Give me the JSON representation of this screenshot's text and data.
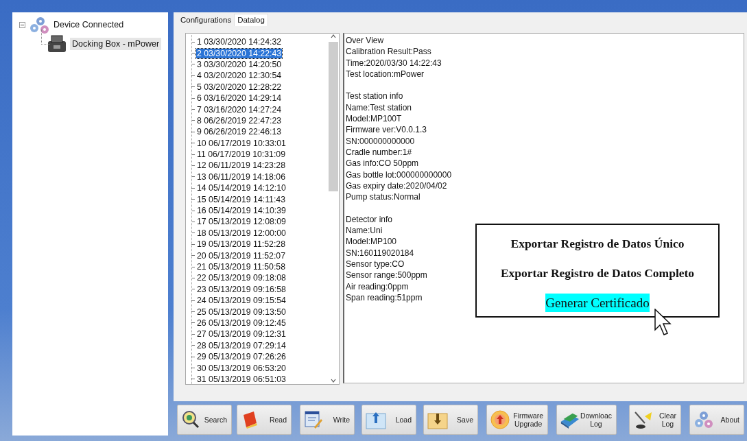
{
  "device_tree": {
    "label": "Device Connected",
    "expanded": true,
    "selected": false,
    "children": [
      {
        "label": "Docking Box - mPower",
        "selected": true
      }
    ]
  },
  "tabs": [
    {
      "label": "Configurations",
      "selected": false
    },
    {
      "label": "Datalog",
      "selected": true
    }
  ],
  "datalog_list": [
    {
      "label": "1 03/30/2020 14:24:32",
      "selected": false
    },
    {
      "label": "2 03/30/2020 14:22:43",
      "selected": true
    },
    {
      "label": "3 03/30/2020 14:20:50",
      "selected": false
    },
    {
      "label": "4 03/20/2020 12:30:54",
      "selected": false
    },
    {
      "label": "5 03/20/2020 12:28:22",
      "selected": false
    },
    {
      "label": "6 03/16/2020 14:29:14",
      "selected": false
    },
    {
      "label": "7 03/16/2020 14:27:24",
      "selected": false
    },
    {
      "label": "8 06/26/2019 22:47:23",
      "selected": false
    },
    {
      "label": "9 06/26/2019 22:46:13",
      "selected": false
    },
    {
      "label": "10 06/17/2019 10:33:01",
      "selected": false
    },
    {
      "label": "11 06/17/2019 10:31:09",
      "selected": false
    },
    {
      "label": "12 06/11/2019 14:23:28",
      "selected": false
    },
    {
      "label": "13 06/11/2019 14:18:06",
      "selected": false
    },
    {
      "label": "14 05/14/2019 14:12:10",
      "selected": false
    },
    {
      "label": "15 05/14/2019 14:11:43",
      "selected": false
    },
    {
      "label": "16 05/14/2019 14:10:39",
      "selected": false
    },
    {
      "label": "17 05/13/2019 12:08:09",
      "selected": false
    },
    {
      "label": "18 05/13/2019 12:00:00",
      "selected": false
    },
    {
      "label": "19 05/13/2019 11:52:28",
      "selected": false
    },
    {
      "label": "20 05/13/2019 11:52:07",
      "selected": false
    },
    {
      "label": "21 05/13/2019 11:50:58",
      "selected": false
    },
    {
      "label": "22 05/13/2019 09:18:08",
      "selected": false
    },
    {
      "label": "23 05/13/2019 09:16:58",
      "selected": false
    },
    {
      "label": "24 05/13/2019 09:15:54",
      "selected": false
    },
    {
      "label": "25 05/13/2019 09:13:50",
      "selected": false
    },
    {
      "label": "26 05/13/2019 09:12:45",
      "selected": false
    },
    {
      "label": "27 05/13/2019 09:12:31",
      "selected": false
    },
    {
      "label": "28 05/13/2019 07:29:14",
      "selected": false
    },
    {
      "label": "29 05/13/2019 07:26:26",
      "selected": false
    },
    {
      "label": "30 05/13/2019 06:53:20",
      "selected": false
    },
    {
      "label": "31 05/13/2019 06:51:03",
      "selected": false
    }
  ],
  "detail_sections": [
    [
      "Over View",
      "Calibration Result:Pass",
      "Time:2020/03/30 14:22:43",
      "Test location:mPower"
    ],
    [
      "Test station info",
      "Name:Test station",
      "Model:MP100T",
      "Firmware ver:V0.0.1.3",
      "SN:000000000000",
      "Cradle number:1#",
      "Gas info:CO 50ppm",
      "Gas bottle lot:000000000000",
      "Gas expiry date:2020/04/02",
      "Pump status:Normal"
    ],
    [
      "Detector info",
      "Name:Uni",
      "Model:MP100",
      "SN:160119020184",
      "Sensor type:CO",
      "Sensor range:500ppm",
      "Air reading:0ppm",
      "Span reading:51ppm"
    ]
  ],
  "context_menu": [
    {
      "label": "Exportar Registro de Datos Único",
      "selected": false
    },
    {
      "label": "Exportar Registro de Datos Completo",
      "selected": false
    },
    {
      "label": "Generar Certificado",
      "selected": true
    }
  ],
  "toolbar": [
    {
      "lines": [
        "Search"
      ]
    },
    {
      "lines": [
        "Read"
      ]
    },
    {
      "lines": [
        "Write"
      ]
    },
    {
      "lines": [
        "Load"
      ]
    },
    {
      "lines": [
        "Save"
      ]
    },
    {
      "lines": [
        "Firmware",
        "Upgrade"
      ]
    },
    {
      "lines": [
        "Downloac",
        "Log"
      ]
    },
    {
      "lines": [
        "Clear",
        "Log"
      ]
    },
    {
      "lines": [
        "About"
      ]
    }
  ]
}
